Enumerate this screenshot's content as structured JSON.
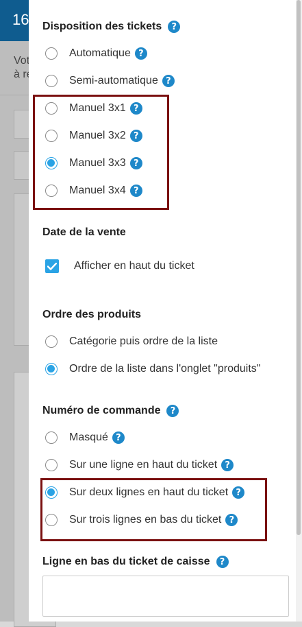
{
  "background": {
    "header_text": "16",
    "text_1": "Vot",
    "text_2": "à re"
  },
  "panel": {
    "sections": {
      "disposition": {
        "title": "Disposition des tickets",
        "options": [
          "Automatique",
          "Semi-automatique",
          "Manuel 3x1",
          "Manuel 3x2",
          "Manuel 3x3",
          "Manuel 3x4"
        ],
        "selected": "Manuel 3x3"
      },
      "date": {
        "title": "Date de la vente",
        "checkbox_label": "Afficher en haut du ticket",
        "checked": true
      },
      "ordre": {
        "title": "Ordre des produits",
        "options": [
          "Catégorie puis ordre de la liste",
          "Ordre de la liste dans l'onglet \"produits\""
        ],
        "selected": "Ordre de la liste dans l'onglet \"produits\""
      },
      "numero": {
        "title": "Numéro de commande",
        "options": [
          "Masqué",
          "Sur une ligne en haut du ticket",
          "Sur deux lignes en haut du ticket",
          "Sur trois lignes en bas du ticket"
        ],
        "selected": "Sur deux lignes en haut du ticket"
      },
      "ligne": {
        "title": "Ligne en bas du ticket de caisse",
        "value": ""
      }
    },
    "help_glyph": "?",
    "colors": {
      "accent": "#2aa3e5",
      "help_icon": "#1e88c9",
      "highlight_border": "#7a1010",
      "header": "#0f5c8f"
    }
  }
}
